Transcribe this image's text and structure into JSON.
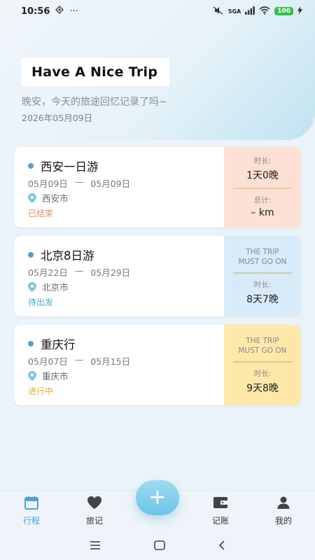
{
  "status": {
    "time": "10:56",
    "more": "···",
    "network": "5GA",
    "battery": "100"
  },
  "header": {
    "title": "Have A Nice Trip",
    "greeting": "晚安，今天的旅途回忆记录了吗~",
    "date": "2026年05月09日"
  },
  "trips": [
    {
      "title": "西安一日游",
      "start": "05月09日",
      "sep": "—",
      "end": "05月09日",
      "location": "西安市",
      "status": "已结束",
      "status_color": "#e0905c",
      "side_bg": "#fde0d4",
      "divider": "#eec7a9",
      "top_label": "时长:",
      "top_value": "1天0晚",
      "bottom_label": "总计:",
      "bottom_value": "– km"
    },
    {
      "title": "北京8日游",
      "start": "05月22日",
      "sep": "—",
      "end": "05月29日",
      "location": "北京市",
      "status": "待出发",
      "status_color": "#4aa3d0",
      "side_bg": "#d9ebf8",
      "divider": "#c9cfa8",
      "top_label": "THE TRIP MUST GO ON",
      "bottom_label": "时长:",
      "bottom_value": "8天7晚"
    },
    {
      "title": "重庆行",
      "start": "05月07日",
      "sep": "—",
      "end": "05月15日",
      "location": "重庆市",
      "status": "进行中",
      "status_color": "#e3a93a",
      "side_bg": "#fde8aa",
      "divider": "#d9c98b",
      "top_label": "THE TRIP MUST GO ON",
      "bottom_label": "时长:",
      "bottom_value": "9天8晚"
    }
  ],
  "tabs": [
    {
      "label": "行程",
      "icon": "calendar-icon"
    },
    {
      "label": "旅记",
      "icon": "heart-icon"
    },
    {
      "label": "记账",
      "icon": "wallet-icon"
    },
    {
      "label": "我的",
      "icon": "user-icon"
    }
  ],
  "fab": {
    "label": "+"
  },
  "colors": {
    "accent": "#4aa3d0"
  }
}
